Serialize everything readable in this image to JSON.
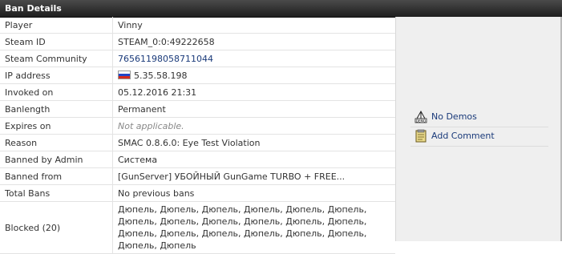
{
  "header": {
    "title": "Ban Details"
  },
  "rows": [
    {
      "label": "Player",
      "value": "Vinny"
    },
    {
      "label": "Steam ID",
      "value": "STEAM_0:0:49222658"
    },
    {
      "label": "Steam Community",
      "value": "76561198058711044"
    },
    {
      "label": "IP address",
      "value": "5.35.58.198",
      "flag_icon": "russia-flag-icon"
    },
    {
      "label": "Invoked on",
      "value": "05.12.2016 21:31"
    },
    {
      "label": "Banlength",
      "value": "Permanent"
    },
    {
      "label": "Expires on",
      "value": "Not applicable."
    },
    {
      "label": "Reason",
      "value": "SMAC 0.8.6.0: Eye Test Violation"
    },
    {
      "label": "Banned by Admin",
      "value": "Система"
    },
    {
      "label": "Banned from",
      "value": "[GunServer] УБОЙНЫЙ GunGame TURBO + FREE..."
    },
    {
      "label": "Total Bans",
      "value": "No previous bans"
    },
    {
      "label": "Blocked (20)",
      "value": "Дюпель, Дюпель, Дюпель, Дюпель, Дюпель, Дюпель, Дюпель, Дюпель, Дюпель, Дюпель, Дюпель, Дюпель, Дюпель, Дюпель, Дюпель, Дюпель, Дюпель, Дюпель, Дюпель, Дюпель"
    }
  ],
  "sidebar": {
    "actions": [
      {
        "label": "No Demos",
        "icon": "demo-icon"
      },
      {
        "label": "Add Comment",
        "icon": "notepad-icon"
      }
    ]
  },
  "colors": {
    "header_bg": "#2b2b2b",
    "link": "#1a3a7a",
    "sidebar_bg": "#efefef"
  }
}
